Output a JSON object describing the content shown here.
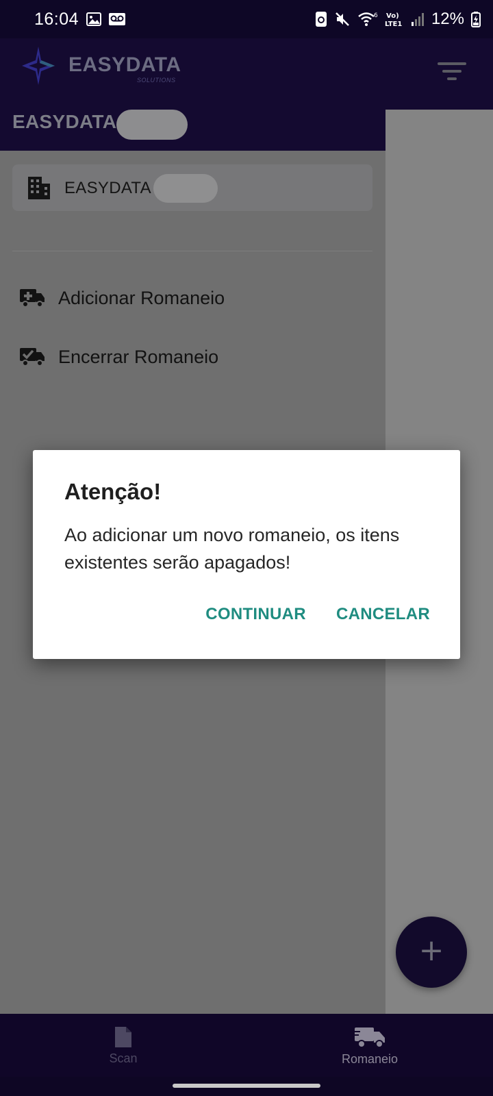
{
  "status_bar": {
    "time": "16:04",
    "battery": "12%",
    "icons": [
      "image-icon",
      "voicemail-icon",
      "sync-icon",
      "mute-icon",
      "wifi-icon",
      "volte-icon",
      "signal-icon",
      "battery-charging-icon"
    ]
  },
  "header": {
    "logo_text": "EASYDATA",
    "logo_subtext": "SOLUTIONS",
    "company_name": "EASYDATA",
    "filter_icon": "filter-icon"
  },
  "drawer": {
    "company_card": {
      "icon": "building-icon",
      "name": "EASYDATA"
    },
    "items": [
      {
        "icon": "truck-add-icon",
        "label": "Adicionar Romaneio"
      },
      {
        "icon": "truck-check-icon",
        "label": "Encerrar Romaneio"
      }
    ]
  },
  "dialog": {
    "title": "Atenção!",
    "message": "Ao adicionar um novo romaneio, os itens existentes serão apagados!",
    "continue_label": "CONTINUAR",
    "cancel_label": "CANCELAR"
  },
  "fab": {
    "symbol": "+"
  },
  "bottom_nav": {
    "items": [
      {
        "icon": "document-icon",
        "label": "Scan"
      },
      {
        "icon": "truck-icon",
        "label": "Romaneio"
      }
    ]
  },
  "colors": {
    "primary_dark": "#140a30",
    "dialog_button": "#1f8c80",
    "scrim_bg": "#848484"
  }
}
